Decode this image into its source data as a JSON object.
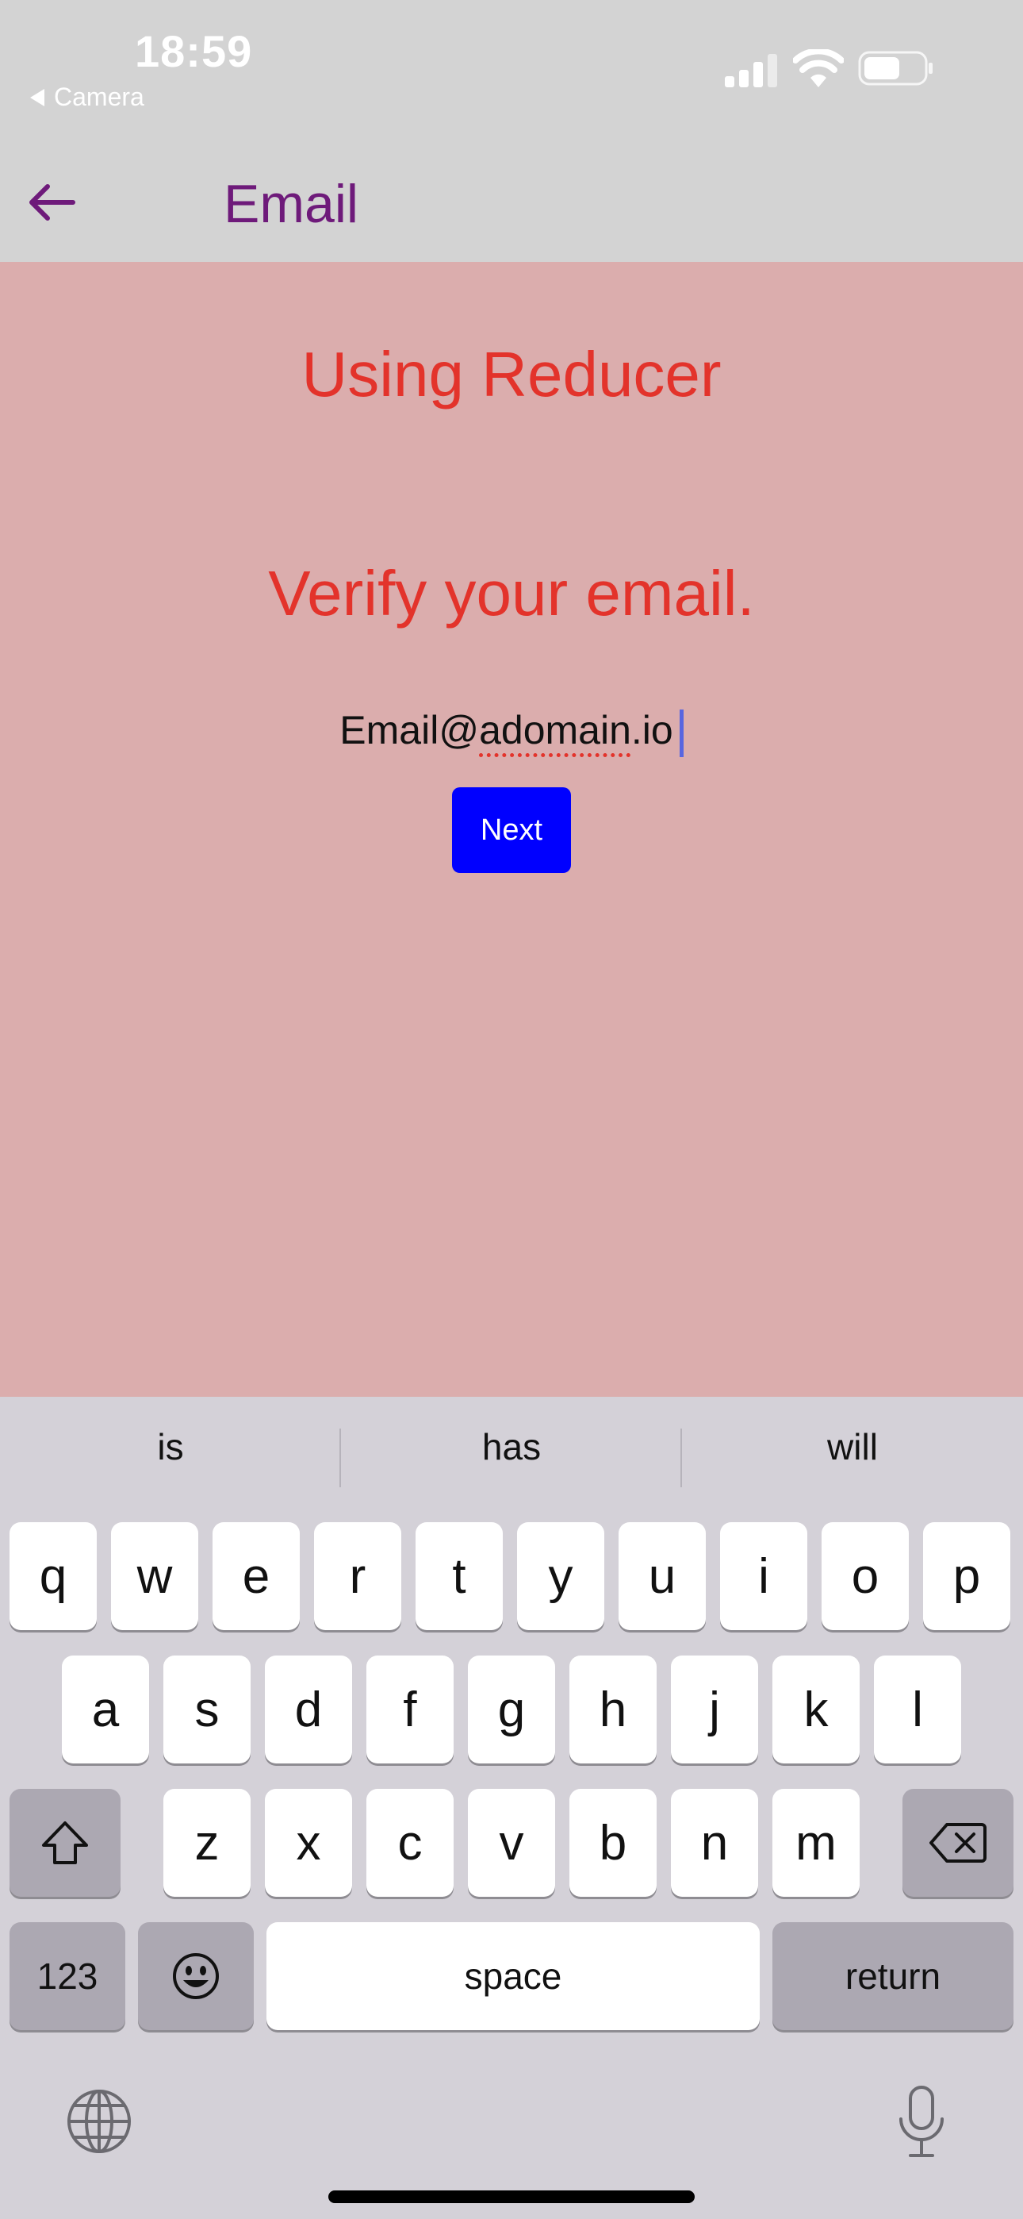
{
  "status_bar": {
    "time": "18:59",
    "back_app_label": "Camera"
  },
  "nav": {
    "title": "Email"
  },
  "content": {
    "heading": "Using Reducer",
    "subheading": "Verify your email.",
    "email_value_prefix": "Email@",
    "email_value_underlined": "adomain",
    "email_value_suffix": ".io",
    "next_label": "Next"
  },
  "keyboard": {
    "suggestions": [
      "is",
      "has",
      "will"
    ],
    "row1": [
      "q",
      "w",
      "e",
      "r",
      "t",
      "y",
      "u",
      "i",
      "o",
      "p"
    ],
    "row2": [
      "a",
      "s",
      "d",
      "f",
      "g",
      "h",
      "j",
      "k",
      "l"
    ],
    "row3": [
      "z",
      "x",
      "c",
      "v",
      "b",
      "n",
      "m"
    ],
    "numbers_label": "123",
    "space_label": "space",
    "return_label": "return"
  },
  "colors": {
    "accent_purple": "#6e1a7a",
    "heading_red": "#e3332b",
    "content_bg": "#dbadad",
    "button_blue": "#0000ff"
  }
}
